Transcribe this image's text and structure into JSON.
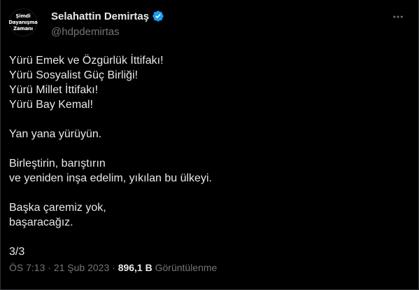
{
  "avatar": {
    "line1": "Şimdi",
    "line2": "Dayanışma",
    "line3": "Zamanı"
  },
  "author": {
    "name": "Selahattin Demirtaş",
    "handle": "@hdpdemirtas",
    "verified": true
  },
  "tweet": {
    "lines": [
      "Yürü Emek ve Özgürlük İttifakı!",
      "Yürü Sosyalist Güç Birliği!",
      "Yürü Millet İttifakı!",
      "Yürü Bay Kemal!",
      "",
      "Yan yana yürüyün.",
      "",
      "Birleştirin, barıştırın",
      "ve yeniden inşa edelim, yıkılan bu ülkeyi.",
      "",
      "Başka çaremiz yok,",
      "başaracağız.",
      "",
      "3/3"
    ]
  },
  "meta": {
    "time": "ÖS 7:13",
    "separator": " · ",
    "date": "21 Şub 2023",
    "views_count": "896,1 B",
    "views_label": "Görüntülenme"
  },
  "colors": {
    "background": "#000000",
    "text": "#e7e9ea",
    "secondary_text": "#71767b",
    "verified_badge": "#1d9bf0"
  },
  "icons": {
    "verified": "verified-badge-icon",
    "more": "more-dots-icon"
  }
}
